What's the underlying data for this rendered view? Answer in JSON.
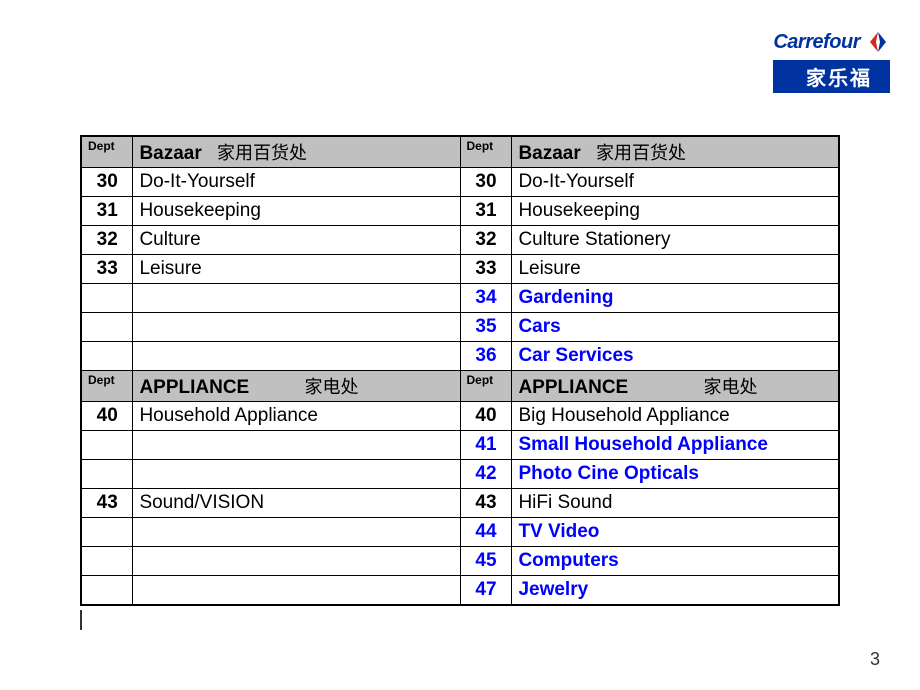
{
  "brand": {
    "name_en": "Carrefour",
    "name_zh": "家乐福"
  },
  "page_number": "3",
  "headers": {
    "dept_label": "Dept",
    "bazaar_en": "Bazaar",
    "bazaar_zh": "家用百货处",
    "appliance_en": "APPLIANCE",
    "appliance_zh": "家电处"
  },
  "left_bazaar": [
    {
      "code": "30",
      "name": "Do-It-Yourself",
      "blue": false
    },
    {
      "code": "31",
      "name": "Housekeeping",
      "blue": false
    },
    {
      "code": "32",
      "name": "Culture",
      "blue": false
    },
    {
      "code": "33",
      "name": "Leisure",
      "blue": false
    },
    {
      "code": "",
      "name": "",
      "blue": false
    },
    {
      "code": "",
      "name": "",
      "blue": false
    },
    {
      "code": "",
      "name": "",
      "blue": false
    }
  ],
  "right_bazaar": [
    {
      "code": "30",
      "name": "Do-It-Yourself",
      "blue": false
    },
    {
      "code": "31",
      "name": "Housekeeping",
      "blue": false
    },
    {
      "code": "32",
      "name": "Culture Stationery",
      "blue": false
    },
    {
      "code": "33",
      "name": "Leisure",
      "blue": false
    },
    {
      "code": "34",
      "name": "Gardening",
      "blue": true
    },
    {
      "code": "35",
      "name": "Cars",
      "blue": true
    },
    {
      "code": "36",
      "name": "Car Services",
      "blue": true
    }
  ],
  "left_appliance": [
    {
      "code": "40",
      "name": "Household Appliance",
      "blue": false
    },
    {
      "code": "",
      "name": "",
      "blue": false
    },
    {
      "code": "",
      "name": "",
      "blue": false
    },
    {
      "code": "43",
      "name": "Sound/VISION",
      "blue": false
    },
    {
      "code": "",
      "name": "",
      "blue": false
    },
    {
      "code": "",
      "name": "",
      "blue": false
    },
    {
      "code": "",
      "name": "",
      "blue": false
    }
  ],
  "right_appliance": [
    {
      "code": "40",
      "name": "Big Household Appliance",
      "blue": false
    },
    {
      "code": "41",
      "name": "Small Household Appliance",
      "blue": true
    },
    {
      "code": "42",
      "name": "Photo Cine Opticals",
      "blue": true
    },
    {
      "code": "43",
      "name": "HiFi Sound",
      "blue": false
    },
    {
      "code": "44",
      "name": "TV Video",
      "blue": true
    },
    {
      "code": "45",
      "name": "Computers",
      "blue": true
    },
    {
      "code": "47",
      "name": "Jewelry",
      "blue": true
    }
  ]
}
